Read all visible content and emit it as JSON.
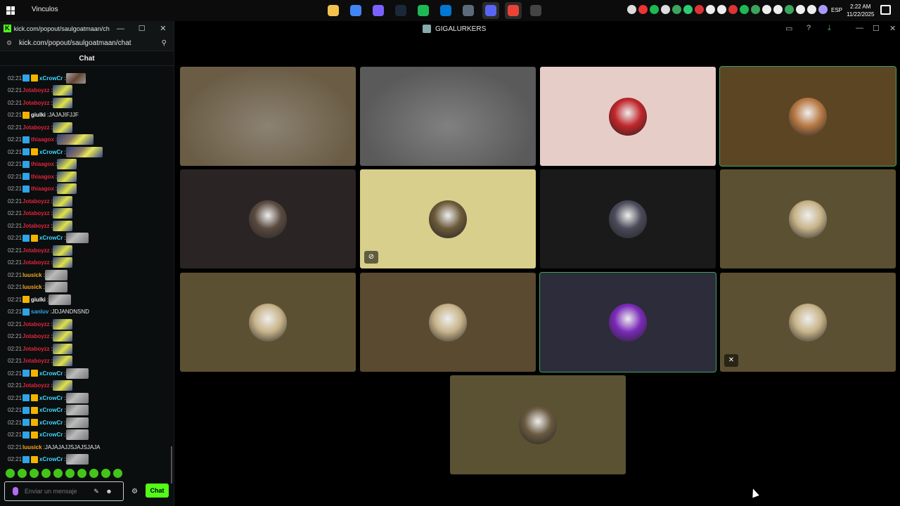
{
  "taskbar": {
    "toolbar_label": "Vinculos",
    "lang": "ESP",
    "time": "2:22 AM",
    "date": "11/22/2025",
    "apps": [
      {
        "name": "file-explorer-icon",
        "color": "#f2c14e"
      },
      {
        "name": "chrome-icon",
        "color": "#4285f4"
      },
      {
        "name": "copilot-icon",
        "color": "#7b61ff"
      },
      {
        "name": "steam-icon",
        "color": "#1b2838"
      },
      {
        "name": "spotify-icon",
        "color": "#1db954"
      },
      {
        "name": "store-icon",
        "color": "#0078d4"
      },
      {
        "name": "files-icon",
        "color": "#5b6b7a"
      },
      {
        "name": "discord-icon",
        "color": "#5865f2"
      },
      {
        "name": "chrome-profile-icon",
        "color": "#ea4335"
      },
      {
        "name": "obs-icon",
        "color": "#444444"
      }
    ]
  },
  "chat_window": {
    "title": "kick.com/popout/saulgoatmaan/cha...",
    "url": "kick.com/popout/saulgoatmaan/chat",
    "header": "Chat",
    "input_placeholder": "Enviar un mensaje",
    "send_label": "Chat",
    "brand_color": "#53fc18",
    "messages": [
      {
        "time": "02:21",
        "user": "xCrowCr",
        "color": "#3ddcff",
        "badges": [
          "mod",
          "sub"
        ],
        "text": "",
        "emote": "face"
      },
      {
        "time": "02:21",
        "user": "Jotaboyzz",
        "color": "#e3243b",
        "badges": [],
        "text": "",
        "emote": "emote"
      },
      {
        "time": "02:21",
        "user": "Jotaboyzz",
        "color": "#e3243b",
        "badges": [],
        "text": "",
        "emote": "emote"
      },
      {
        "time": "02:21",
        "user": "giulki",
        "color": "#f2f2f2",
        "badges": [
          "sub"
        ],
        "text": "JAJAJIFJJF",
        "emote": ""
      },
      {
        "time": "02:21",
        "user": "Jotaboyzz",
        "color": "#e3243b",
        "badges": [],
        "text": "",
        "emote": "emote"
      },
      {
        "time": "02:21",
        "user": "thiaagox",
        "color": "#e3243b",
        "badges": [
          "mod"
        ],
        "text": "",
        "emote": "wide"
      },
      {
        "time": "02:21",
        "user": "xCrowCr",
        "color": "#3ddcff",
        "badges": [
          "mod",
          "sub"
        ],
        "text": "",
        "emote": "wide"
      },
      {
        "time": "02:21",
        "user": "thiaagox",
        "color": "#e3243b",
        "badges": [
          "mod"
        ],
        "text": "",
        "emote": "emote"
      },
      {
        "time": "02:21",
        "user": "thiaagox",
        "color": "#e3243b",
        "badges": [
          "mod"
        ],
        "text": "",
        "emote": "emote"
      },
      {
        "time": "02:21",
        "user": "thiaagox",
        "color": "#e3243b",
        "badges": [
          "mod"
        ],
        "text": "",
        "emote": "emote"
      },
      {
        "time": "02:21",
        "user": "Jotaboyzz",
        "color": "#e3243b",
        "badges": [],
        "text": "",
        "emote": "emote"
      },
      {
        "time": "02:21",
        "user": "Jotaboyzz",
        "color": "#e3243b",
        "badges": [],
        "text": "",
        "emote": "emote"
      },
      {
        "time": "02:21",
        "user": "Jotaboyzz",
        "color": "#e3243b",
        "badges": [],
        "text": "",
        "emote": "emote"
      },
      {
        "time": "02:21",
        "user": "xCrowCr",
        "color": "#3ddcff",
        "badges": [
          "mod",
          "sub"
        ],
        "text": "",
        "emote": "grey"
      },
      {
        "time": "02:21",
        "user": "Jotaboyzz",
        "color": "#e3243b",
        "badges": [],
        "text": "",
        "emote": "emote"
      },
      {
        "time": "02:21",
        "user": "Jotaboyzz",
        "color": "#e3243b",
        "badges": [],
        "text": "",
        "emote": "emote"
      },
      {
        "time": "02:21",
        "user": "luusick",
        "color": "#f5a623",
        "badges": [],
        "text": "",
        "emote": "grey"
      },
      {
        "time": "02:21",
        "user": "luusick",
        "color": "#f5a623",
        "badges": [],
        "text": "",
        "emote": "grey"
      },
      {
        "time": "02:21",
        "user": "giulki",
        "color": "#f2f2f2",
        "badges": [
          "sub"
        ],
        "text": "",
        "emote": "grey"
      },
      {
        "time": "02:21",
        "user": "sanluv",
        "color": "#2fa4e7",
        "badges": [
          "mod"
        ],
        "text": "JDJANDNSND",
        "emote": ""
      },
      {
        "time": "02:21",
        "user": "Jotaboyzz",
        "color": "#e3243b",
        "badges": [],
        "text": "",
        "emote": "emote"
      },
      {
        "time": "02:21",
        "user": "Jotaboyzz",
        "color": "#e3243b",
        "badges": [],
        "text": "",
        "emote": "emote"
      },
      {
        "time": "02:21",
        "user": "Jotaboyzz",
        "color": "#e3243b",
        "badges": [],
        "text": "",
        "emote": "emote"
      },
      {
        "time": "02:21",
        "user": "Jotaboyzz",
        "color": "#e3243b",
        "badges": [],
        "text": "",
        "emote": "emote"
      },
      {
        "time": "02:21",
        "user": "xCrowCr",
        "color": "#3ddcff",
        "badges": [
          "mod",
          "sub"
        ],
        "text": "",
        "emote": "grey"
      },
      {
        "time": "02:21",
        "user": "Jotaboyzz",
        "color": "#e3243b",
        "badges": [],
        "text": "",
        "emote": "emote"
      },
      {
        "time": "02:21",
        "user": "xCrowCr",
        "color": "#3ddcff",
        "badges": [
          "mod",
          "sub"
        ],
        "text": "",
        "emote": "grey"
      },
      {
        "time": "02:21",
        "user": "xCrowCr",
        "color": "#3ddcff",
        "badges": [
          "mod",
          "sub"
        ],
        "text": "",
        "emote": "grey"
      },
      {
        "time": "02:21",
        "user": "xCrowCr",
        "color": "#3ddcff",
        "badges": [
          "mod",
          "sub"
        ],
        "text": "",
        "emote": "grey"
      },
      {
        "time": "02:21",
        "user": "xCrowCr",
        "color": "#3ddcff",
        "badges": [
          "mod",
          "sub"
        ],
        "text": "",
        "emote": "grey"
      },
      {
        "time": "02:21",
        "user": "luusick",
        "color": "#f5a623",
        "badges": [],
        "text": "JAJAJAJJSJAJSJAJA",
        "emote": ""
      },
      {
        "time": "02:21",
        "user": "xCrowCr",
        "color": "#3ddcff",
        "badges": [
          "mod",
          "sub"
        ],
        "text": "",
        "emote": "grey"
      }
    ]
  },
  "call": {
    "server_name": "GIGALURKERS",
    "tiles": [
      {
        "bg": "#6b5d45",
        "avatar": "none",
        "speaking": false,
        "badge": ""
      },
      {
        "bg": "#5a5a5a",
        "avatar": "none",
        "speaking": false,
        "badge": ""
      },
      {
        "bg": "#e6cdc8",
        "avatar": "#c0262a",
        "speaking": false,
        "badge": ""
      },
      {
        "bg": "#5c4523",
        "avatar": "#b87a45",
        "speaking": true,
        "badge": ""
      },
      {
        "bg": "#2a2424",
        "avatar": "#5a4a40",
        "speaking": false,
        "badge": ""
      },
      {
        "bg": "#d8cf8c",
        "avatar": "#6b5a3a",
        "speaking": false,
        "badge": "video-off-icon"
      },
      {
        "bg": "#1a1a1a",
        "avatar": "#4a4a5a",
        "speaking": false,
        "badge": ""
      },
      {
        "bg": "#5c5032",
        "avatar": "#c8b48a",
        "speaking": false,
        "badge": ""
      },
      {
        "bg": "#5c5032",
        "avatar": "#c8b48a",
        "speaking": false,
        "badge": ""
      },
      {
        "bg": "#5a4a30",
        "avatar": "#c8b48a",
        "speaking": false,
        "badge": ""
      },
      {
        "bg": "#2c2c3a",
        "avatar": "#7a2ab8",
        "speaking": true,
        "badge": ""
      },
      {
        "bg": "#5c5032",
        "avatar": "#c8b48a",
        "speaking": false,
        "badge": "mic-muted-icon"
      },
      {
        "bg": "#5a5232",
        "avatar": "#6a5a40",
        "speaking": false,
        "badge": ""
      }
    ]
  }
}
